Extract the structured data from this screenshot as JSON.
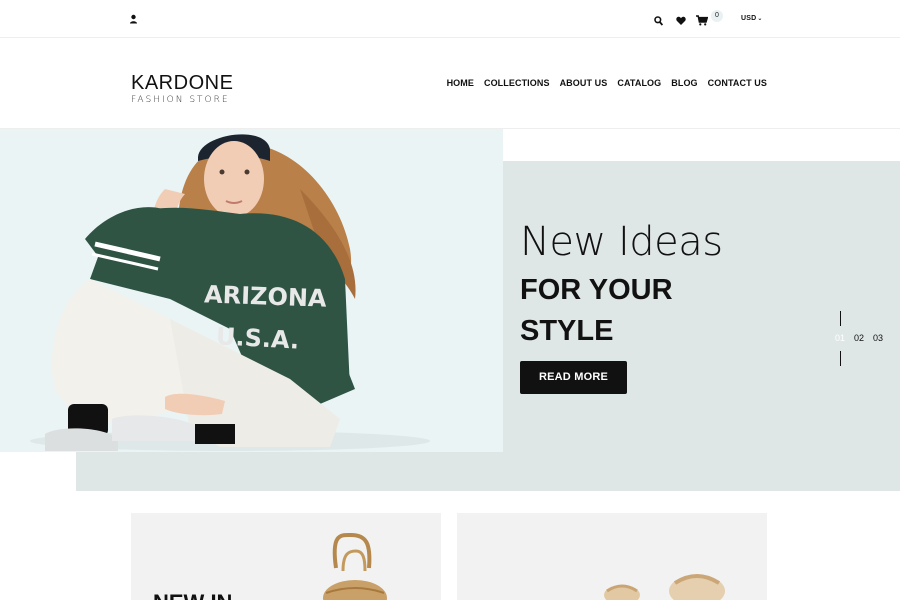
{
  "topbar": {
    "cart_count": "0",
    "currency": "USD"
  },
  "header": {
    "logo_main": "KARDONE",
    "logo_sub": "FASHION STORE",
    "nav": [
      "HOME",
      "COLLECTIONS",
      "ABOUT US",
      "CATALOG",
      "BLOG",
      "CONTACT US"
    ]
  },
  "hero": {
    "heading_light": "New Ideas",
    "heading_bold": "FOR YOUR STYLE",
    "button_label": "READ MORE",
    "image_text_line1": "ARIZONA",
    "image_text_line2": "U.S.A.",
    "slides": [
      "01",
      "02",
      "03"
    ],
    "active_slide": "01"
  },
  "tiles": {
    "left_label": "NEW IN"
  },
  "colors": {
    "accent_dark": "#111111",
    "hero_panel": "#dfe6e6",
    "hero_image_bg": "#eaf4f5",
    "sweater_green": "#2f5444"
  },
  "icons": [
    "user-icon",
    "search-icon",
    "heart-icon",
    "cart-icon",
    "chevron-down-icon"
  ]
}
